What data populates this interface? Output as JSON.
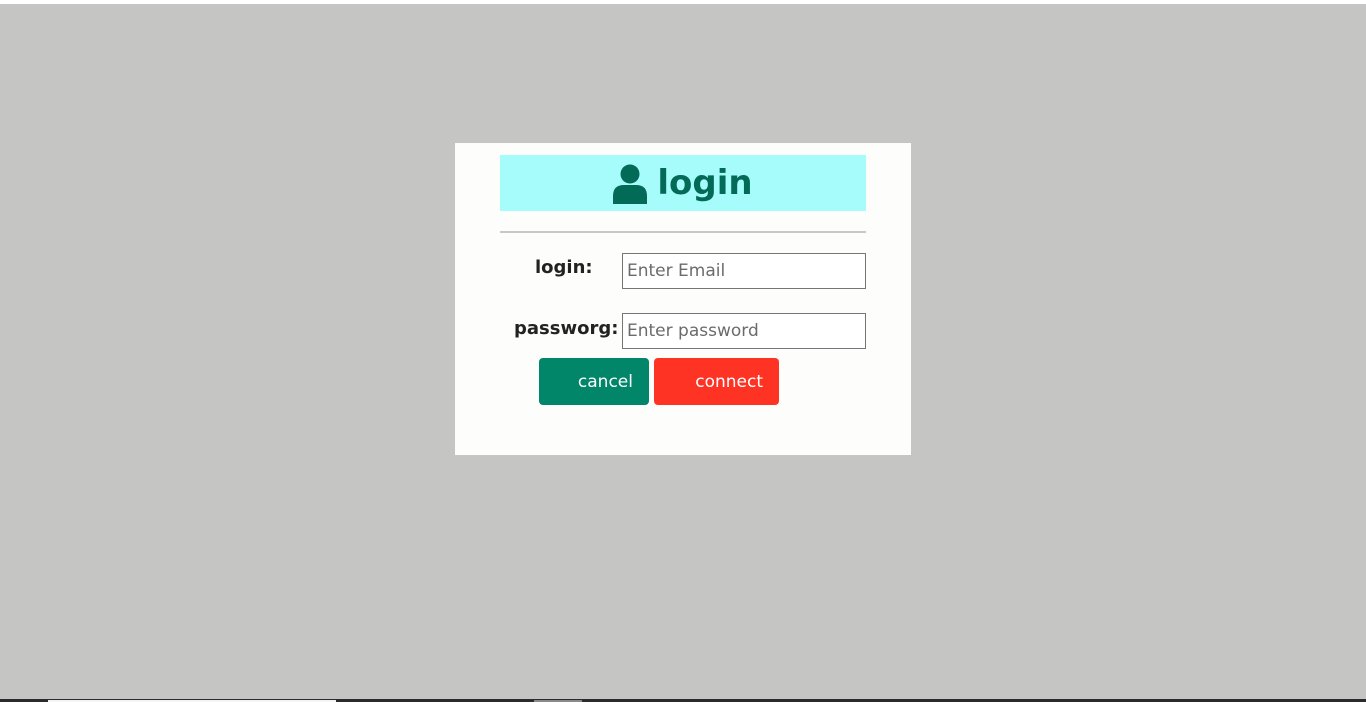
{
  "colors": {
    "page_background": "#c5c5c3",
    "panel_background": "#fdfdfb",
    "header_background": "#a6fbfb",
    "header_text": "#036a57",
    "cancel_button": "#02866a",
    "connect_button": "#ff3324"
  },
  "header": {
    "icon": "user-icon",
    "title": "login"
  },
  "form": {
    "login_label": "login:",
    "email_placeholder": "Enter Email",
    "email_value": "",
    "password_label": "passworg:",
    "password_placeholder": "Enter password",
    "password_value": ""
  },
  "buttons": {
    "cancel_label": "cancel",
    "connect_label": "connect"
  }
}
